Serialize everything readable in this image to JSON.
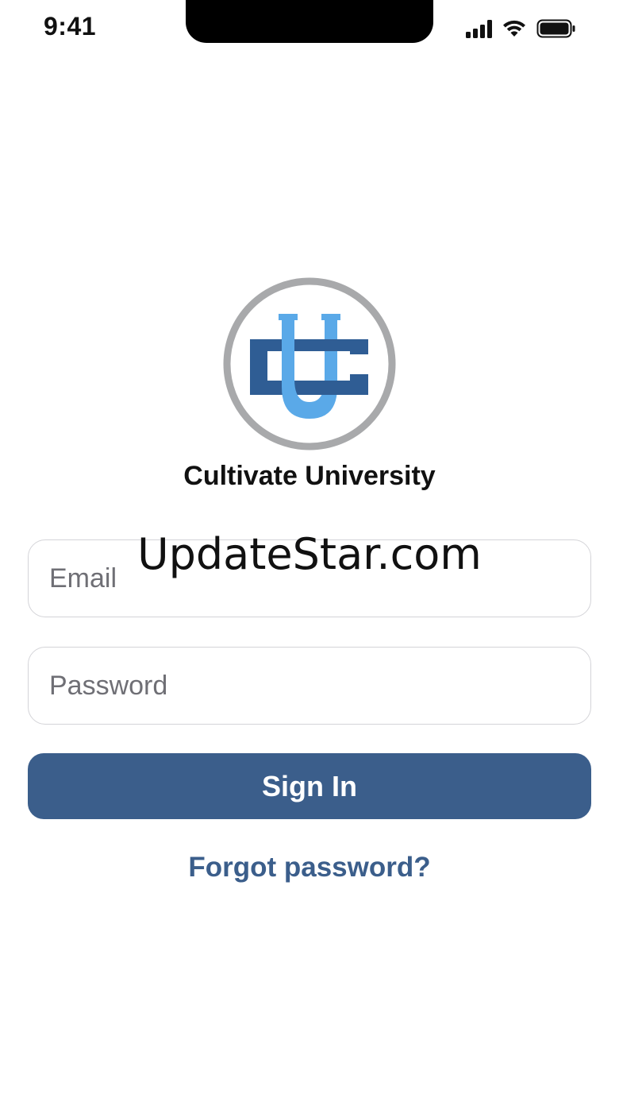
{
  "status_bar": {
    "time": "9:41",
    "icons": [
      "signal-icon",
      "wifi-icon",
      "battery-icon"
    ]
  },
  "logo": {
    "icon": "cultivate-university-logo",
    "colors": {
      "ring": "#a8a9ab",
      "dark_blue": "#2f5d94",
      "light_blue": "#5aa9e8"
    }
  },
  "app": {
    "name": "Cultivate University"
  },
  "form": {
    "email_placeholder": "Email",
    "email_value": "",
    "password_placeholder": "Password",
    "password_value": "",
    "sign_in_label": "Sign In",
    "forgot_label": "Forgot password?"
  },
  "watermark": {
    "text": "UpdateStar.com"
  },
  "colors": {
    "accent": "#3b5e8b",
    "background": "#ffffff"
  }
}
